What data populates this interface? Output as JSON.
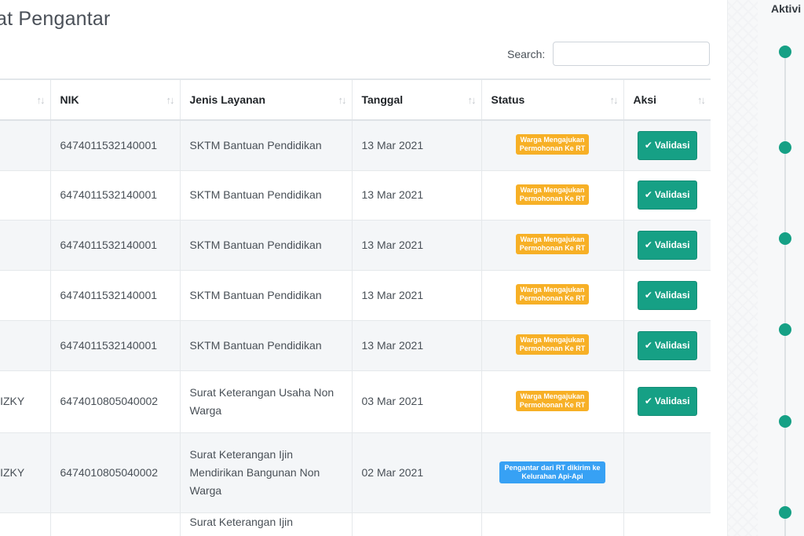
{
  "page": {
    "title": "at Pengantar"
  },
  "search": {
    "label": "Search:",
    "placeholder": ""
  },
  "table": {
    "columns": [
      "",
      "NIK",
      "Jenis Layanan",
      "Tanggal",
      "Status",
      "Aksi"
    ],
    "sort_icon": "↑↓",
    "rows": [
      {
        "name": "",
        "nik": "6474011532140001",
        "layanan": "SKTM Bantuan Pendidikan",
        "tanggal": "13 Mar 2021",
        "status_line1": "Warga Mengajukan",
        "status_line2": "Permohonan Ke RT",
        "status_type": "warning",
        "action": "Validasi"
      },
      {
        "name": "",
        "nik": "6474011532140001",
        "layanan": "SKTM Bantuan Pendidikan",
        "tanggal": "13 Mar 2021",
        "status_line1": "Warga Mengajukan",
        "status_line2": "Permohonan Ke RT",
        "status_type": "warning",
        "action": "Validasi"
      },
      {
        "name": "",
        "nik": "6474011532140001",
        "layanan": "SKTM Bantuan Pendidikan",
        "tanggal": "13 Mar 2021",
        "status_line1": "Warga Mengajukan",
        "status_line2": "Permohonan Ke RT",
        "status_type": "warning",
        "action": "Validasi"
      },
      {
        "name": "",
        "nik": "6474011532140001",
        "layanan": "SKTM Bantuan Pendidikan",
        "tanggal": "13 Mar 2021",
        "status_line1": "Warga Mengajukan",
        "status_line2": "Permohonan Ke RT",
        "status_type": "warning",
        "action": "Validasi"
      },
      {
        "name": "",
        "nik": "6474011532140001",
        "layanan": "SKTM Bantuan Pendidikan",
        "tanggal": "13 Mar 2021",
        "status_line1": "Warga Mengajukan",
        "status_line2": "Permohonan Ke RT",
        "status_type": "warning",
        "action": "Validasi"
      },
      {
        "name": "RIZKY",
        "nik": "6474010805040002",
        "layanan": "Surat Keterangan Usaha Non Warga",
        "tanggal": "03 Mar 2021",
        "status_line1": "Warga Mengajukan",
        "status_line2": "Permohonan Ke RT",
        "status_type": "warning",
        "action": "Validasi"
      },
      {
        "name": "RIZKY",
        "nik": "6474010805040002",
        "layanan": "Surat Keterangan Ijin Mendirikan Bangunan Non Warga",
        "tanggal": "02 Mar 2021",
        "status_line1": "Pengantar dari RT dikirim ke",
        "status_line2": "Kelurahan Api-Api",
        "status_type": "info",
        "action": ""
      },
      {
        "name": "",
        "nik": "",
        "layanan": "Surat Keterangan Ijin",
        "tanggal": "",
        "status_line1": "",
        "status_line2": "",
        "status_type": "warning",
        "action": ""
      }
    ]
  },
  "right_panel": {
    "title": "Aktivi"
  },
  "colors": {
    "accent": "#16a085",
    "warning": "#f7b026",
    "info": "#37a1f4"
  },
  "icons": {
    "check": "check-icon"
  }
}
